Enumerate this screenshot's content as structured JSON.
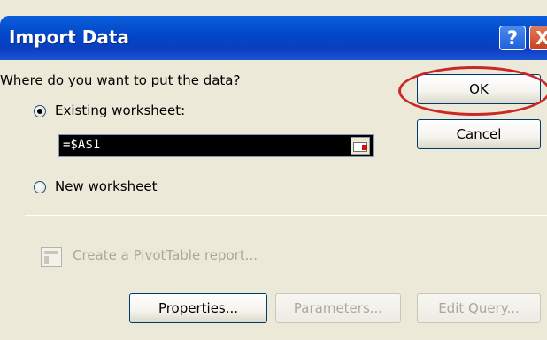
{
  "window": {
    "title": "Import Data",
    "help_label": "?",
    "close_label": "X"
  },
  "prompt": "Where do you want to put the data?",
  "options": {
    "existing_label": "Existing worksheet:",
    "existing_selected": true,
    "new_label": "New worksheet",
    "new_selected": false
  },
  "address": {
    "value": "=$A$1"
  },
  "buttons": {
    "ok": "OK",
    "cancel": "Cancel",
    "properties": "Properties...",
    "parameters": "Parameters...",
    "edit_query": "Edit Query..."
  },
  "pivot": {
    "link": "Create a PivotTable report..."
  },
  "colors": {
    "titlebar": "#0346c8",
    "highlight_ring": "#c8282a",
    "disabled_text": "#aca899"
  }
}
